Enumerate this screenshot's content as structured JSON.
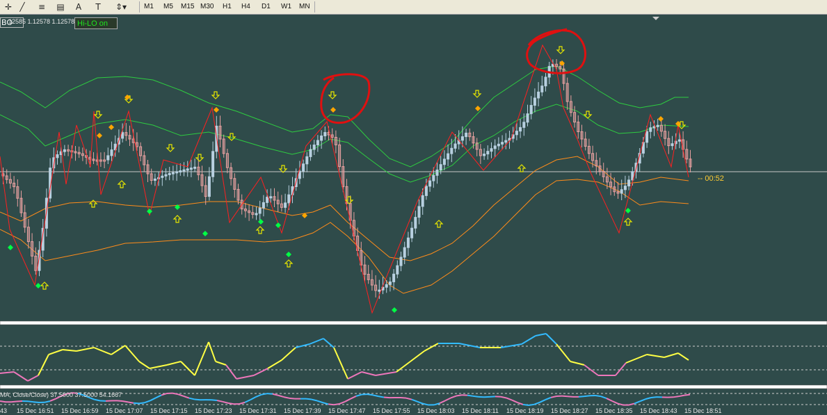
{
  "toolbar": {
    "timeframes": [
      "M1",
      "M5",
      "M15",
      "M30",
      "H1",
      "H4",
      "D1",
      "W1",
      "MN"
    ],
    "icons": [
      "crosshair-icon",
      "trendline-icon",
      "fibonacci-icon",
      "fibonacci-fan-icon",
      "text-icon",
      "label-icon",
      "arrow-tool-icon"
    ]
  },
  "chart": {
    "price_info": "12585 1.12578 1.12578",
    "mode_label": "BO",
    "hilo_label": "Hi-LO on",
    "countdown": "-- 00:52",
    "indicator_label": "MA, Close/Close) 37.5000 37.5000 54.1667",
    "time_labels": [
      "43",
      "15 Dec 16:51",
      "15 Dec 16:59",
      "15 Dec 17:07",
      "15 Dec 17:15",
      "15 Dec 17:23",
      "15 Dec 17:31",
      "15 Dec 17:39",
      "15 Dec 17:47",
      "15 Dec 17:55",
      "15 Dec 18:03",
      "15 Dec 18:11",
      "15 Dec 18:19",
      "15 Dec 18:27",
      "15 Dec 18:35",
      "15 Dec 18:43",
      "15 Dec 18:51"
    ]
  },
  "colors": {
    "background": "#2f4b4a",
    "bull_candle": "#b8d0e0",
    "bear_candle": "#e8a0a0",
    "upper_band": "#2ecc40",
    "lower_band": "#ff8c1a",
    "zigzag": "#ff2020",
    "arrow": "#e6e600",
    "diamond_buy": "#00ff44",
    "diamond_sell": "#ffa500",
    "osc_up": "#33bbff",
    "osc_down": "#ee77bb",
    "osc_mid": "#ffff44",
    "annotation": "#e01010"
  }
}
